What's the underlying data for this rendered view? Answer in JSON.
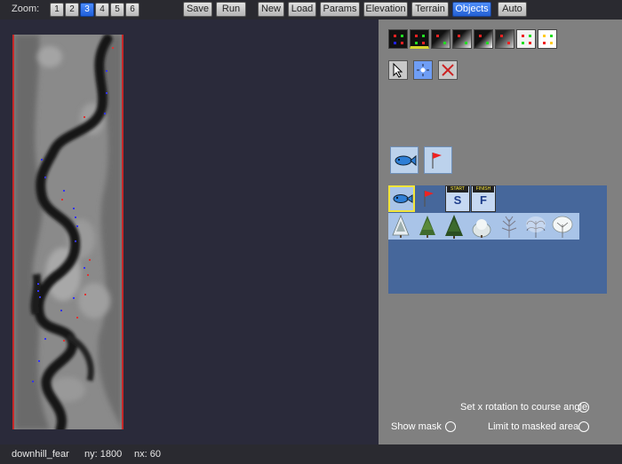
{
  "toolbar": {
    "zoom_label": "Zoom:",
    "zoom_levels": [
      "1",
      "2",
      "3",
      "4",
      "5",
      "6"
    ],
    "zoom_selected": "3",
    "buttons": {
      "save": "Save",
      "run": "Run",
      "new": "New",
      "load": "Load",
      "params": "Params",
      "elevation": "Elevation",
      "terrain": "Terrain",
      "objects": "Objects",
      "auto": "Auto"
    },
    "active_tab": "Objects"
  },
  "panel": {
    "color_swatches": [
      "black-red-blue",
      "black-red-green",
      "black-grey",
      "black-white-grey",
      "black-white",
      "black-grey-red",
      "white-red-green",
      "white-yellow-red"
    ],
    "selected_swatch": "black-red-green",
    "tools": [
      "select-arrow-icon",
      "place-object-icon",
      "delete-icon"
    ],
    "selected_tool": "place-object-icon",
    "recent_objects": [
      "fish-icon",
      "red-flag-icon"
    ],
    "palette_objects": [
      "fish-icon",
      "red-flag-icon",
      "start-gate-icon",
      "finish-gate-icon"
    ],
    "start_header": "START",
    "start_letter": "S",
    "finish_header": "FINISH",
    "finish_letter": "F",
    "trees": [
      "snowy-pine-icon",
      "pine-tree-icon",
      "pine-tree-dark-icon",
      "snowy-bush-icon",
      "bare-tree-icon",
      "frosted-tree-icon",
      "snowy-deciduous-icon"
    ],
    "options": {
      "set_x_rotation": "Set x rotation to course angle",
      "show_mask": "Show mask",
      "limit_to_masked": "Limit to masked area"
    }
  },
  "status": {
    "name": "downhill_fear",
    "ny": "ny: 1800",
    "nx": "nx: 60"
  },
  "colors": {
    "toolbar_bg": "#2a2a30",
    "canvas_bg": "#2a2a3a",
    "panel_bg": "#808080",
    "palette_bg": "#46679b",
    "accent": "#2f6fe8",
    "course_border": "#c62828"
  }
}
